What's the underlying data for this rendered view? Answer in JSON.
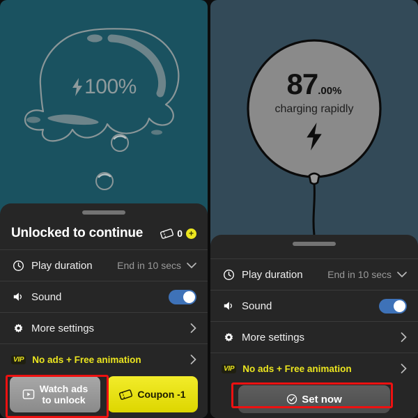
{
  "left_phone": {
    "artwork": {
      "name": "slime-blob-battery",
      "percent_label": "100%",
      "bolt_icon": "lightning-bolt-icon",
      "background_color": "#1a5260",
      "outline_color": "#8a9698"
    },
    "sheet": {
      "title": "Unlocked to continue",
      "coupon_badge": {
        "ticket_icon": "ticket-icon",
        "count": "0",
        "plus_icon": "plus-icon"
      },
      "rows": [
        {
          "icon": "clock-icon",
          "label": "Play duration",
          "value": "End in 10 secs",
          "trailing": "chevron-down-icon"
        },
        {
          "icon": "speaker-icon",
          "label": "Sound",
          "value": "",
          "trailing": "toggle-on"
        },
        {
          "icon": "gear-icon",
          "label": "More settings",
          "value": "",
          "trailing": "chevron-right-icon"
        },
        {
          "icon": "vip-icon",
          "label": "No ads + Free animation",
          "value": "",
          "trailing": "chevron-right-icon",
          "badge": "VIP"
        }
      ],
      "buttons": {
        "watch_ads": {
          "icon": "video-ad-icon",
          "line1": "Watch ads",
          "line2": "to unlock"
        },
        "coupon": {
          "icon": "ticket-icon",
          "label": "Coupon -1"
        }
      }
    }
  },
  "right_phone": {
    "artwork": {
      "name": "balloon-battery",
      "percent_whole": "87",
      "percent_fraction": ".00%",
      "status": "charging rapidly",
      "bolt_icon": "lightning-bolt-icon",
      "background_color": "#334a58",
      "balloon_color": "#8a8a8a"
    },
    "sheet": {
      "rows": [
        {
          "icon": "clock-icon",
          "label": "Play duration",
          "value": "End in 10 secs",
          "trailing": "chevron-down-icon"
        },
        {
          "icon": "speaker-icon",
          "label": "Sound",
          "value": "",
          "trailing": "toggle-on"
        },
        {
          "icon": "gear-icon",
          "label": "More settings",
          "value": "",
          "trailing": "chevron-right-icon"
        },
        {
          "icon": "vip-icon",
          "label": "No ads + Free animation",
          "value": "",
          "trailing": "chevron-right-icon",
          "badge": "VIP"
        }
      ],
      "buttons": {
        "set_now": {
          "icon": "check-circle-icon",
          "label": "Set now"
        }
      }
    }
  },
  "annotations": {
    "highlight_color": "#ee1111",
    "boxes": [
      "watch-ads-to-unlock-button",
      "set-now-button"
    ]
  }
}
